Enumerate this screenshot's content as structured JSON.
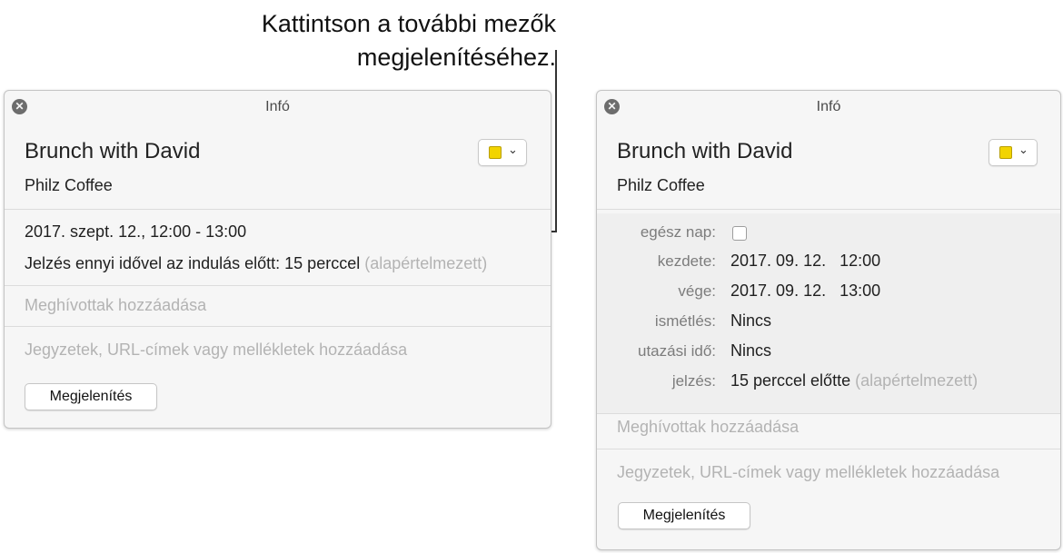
{
  "callout": {
    "line1": "Kattintson a további mezők",
    "line2": "megjelenítéséhez."
  },
  "left_panel": {
    "window_title": "Infó",
    "close_icon": "close-icon",
    "event_title": "Brunch with David",
    "location": "Philz Coffee",
    "calendar_color": "#f2d400",
    "date_time": "2017. szept. 12., 12:00 - 13:00",
    "alert_text": "Jelzés ennyi idővel az indulás előtt: 15 perccel",
    "alert_default": "(alapértelmezett)",
    "invitees_placeholder": "Meghívottak hozzáadása",
    "notes_placeholder": "Jegyzetek, URL-címek vagy mellékletek hozzáadása",
    "show_button": "Megjelenítés"
  },
  "right_panel": {
    "window_title": "Infó",
    "close_icon": "close-icon",
    "event_title": "Brunch with David",
    "location": "Philz Coffee",
    "calendar_color": "#f2d400",
    "all_day_label": "egész nap:",
    "all_day_checked": false,
    "start_label": "kezdete:",
    "start_value": "2017. 09. 12.   12:00",
    "end_label": "vége:",
    "end_value": "2017. 09. 12.   13:00",
    "repeat_label": "ismétlés:",
    "repeat_value": "Nincs",
    "travel_label": "utazási idő:",
    "travel_value": "Nincs",
    "alert_label": "jelzés:",
    "alert_value": "15 perccel előtte",
    "alert_default": "(alapértelmezett)",
    "invitees_placeholder": "Meghívottak hozzáadása",
    "notes_placeholder": "Jegyzetek, URL-címek vagy mellékletek hozzáadása",
    "show_button": "Megjelenítés"
  }
}
